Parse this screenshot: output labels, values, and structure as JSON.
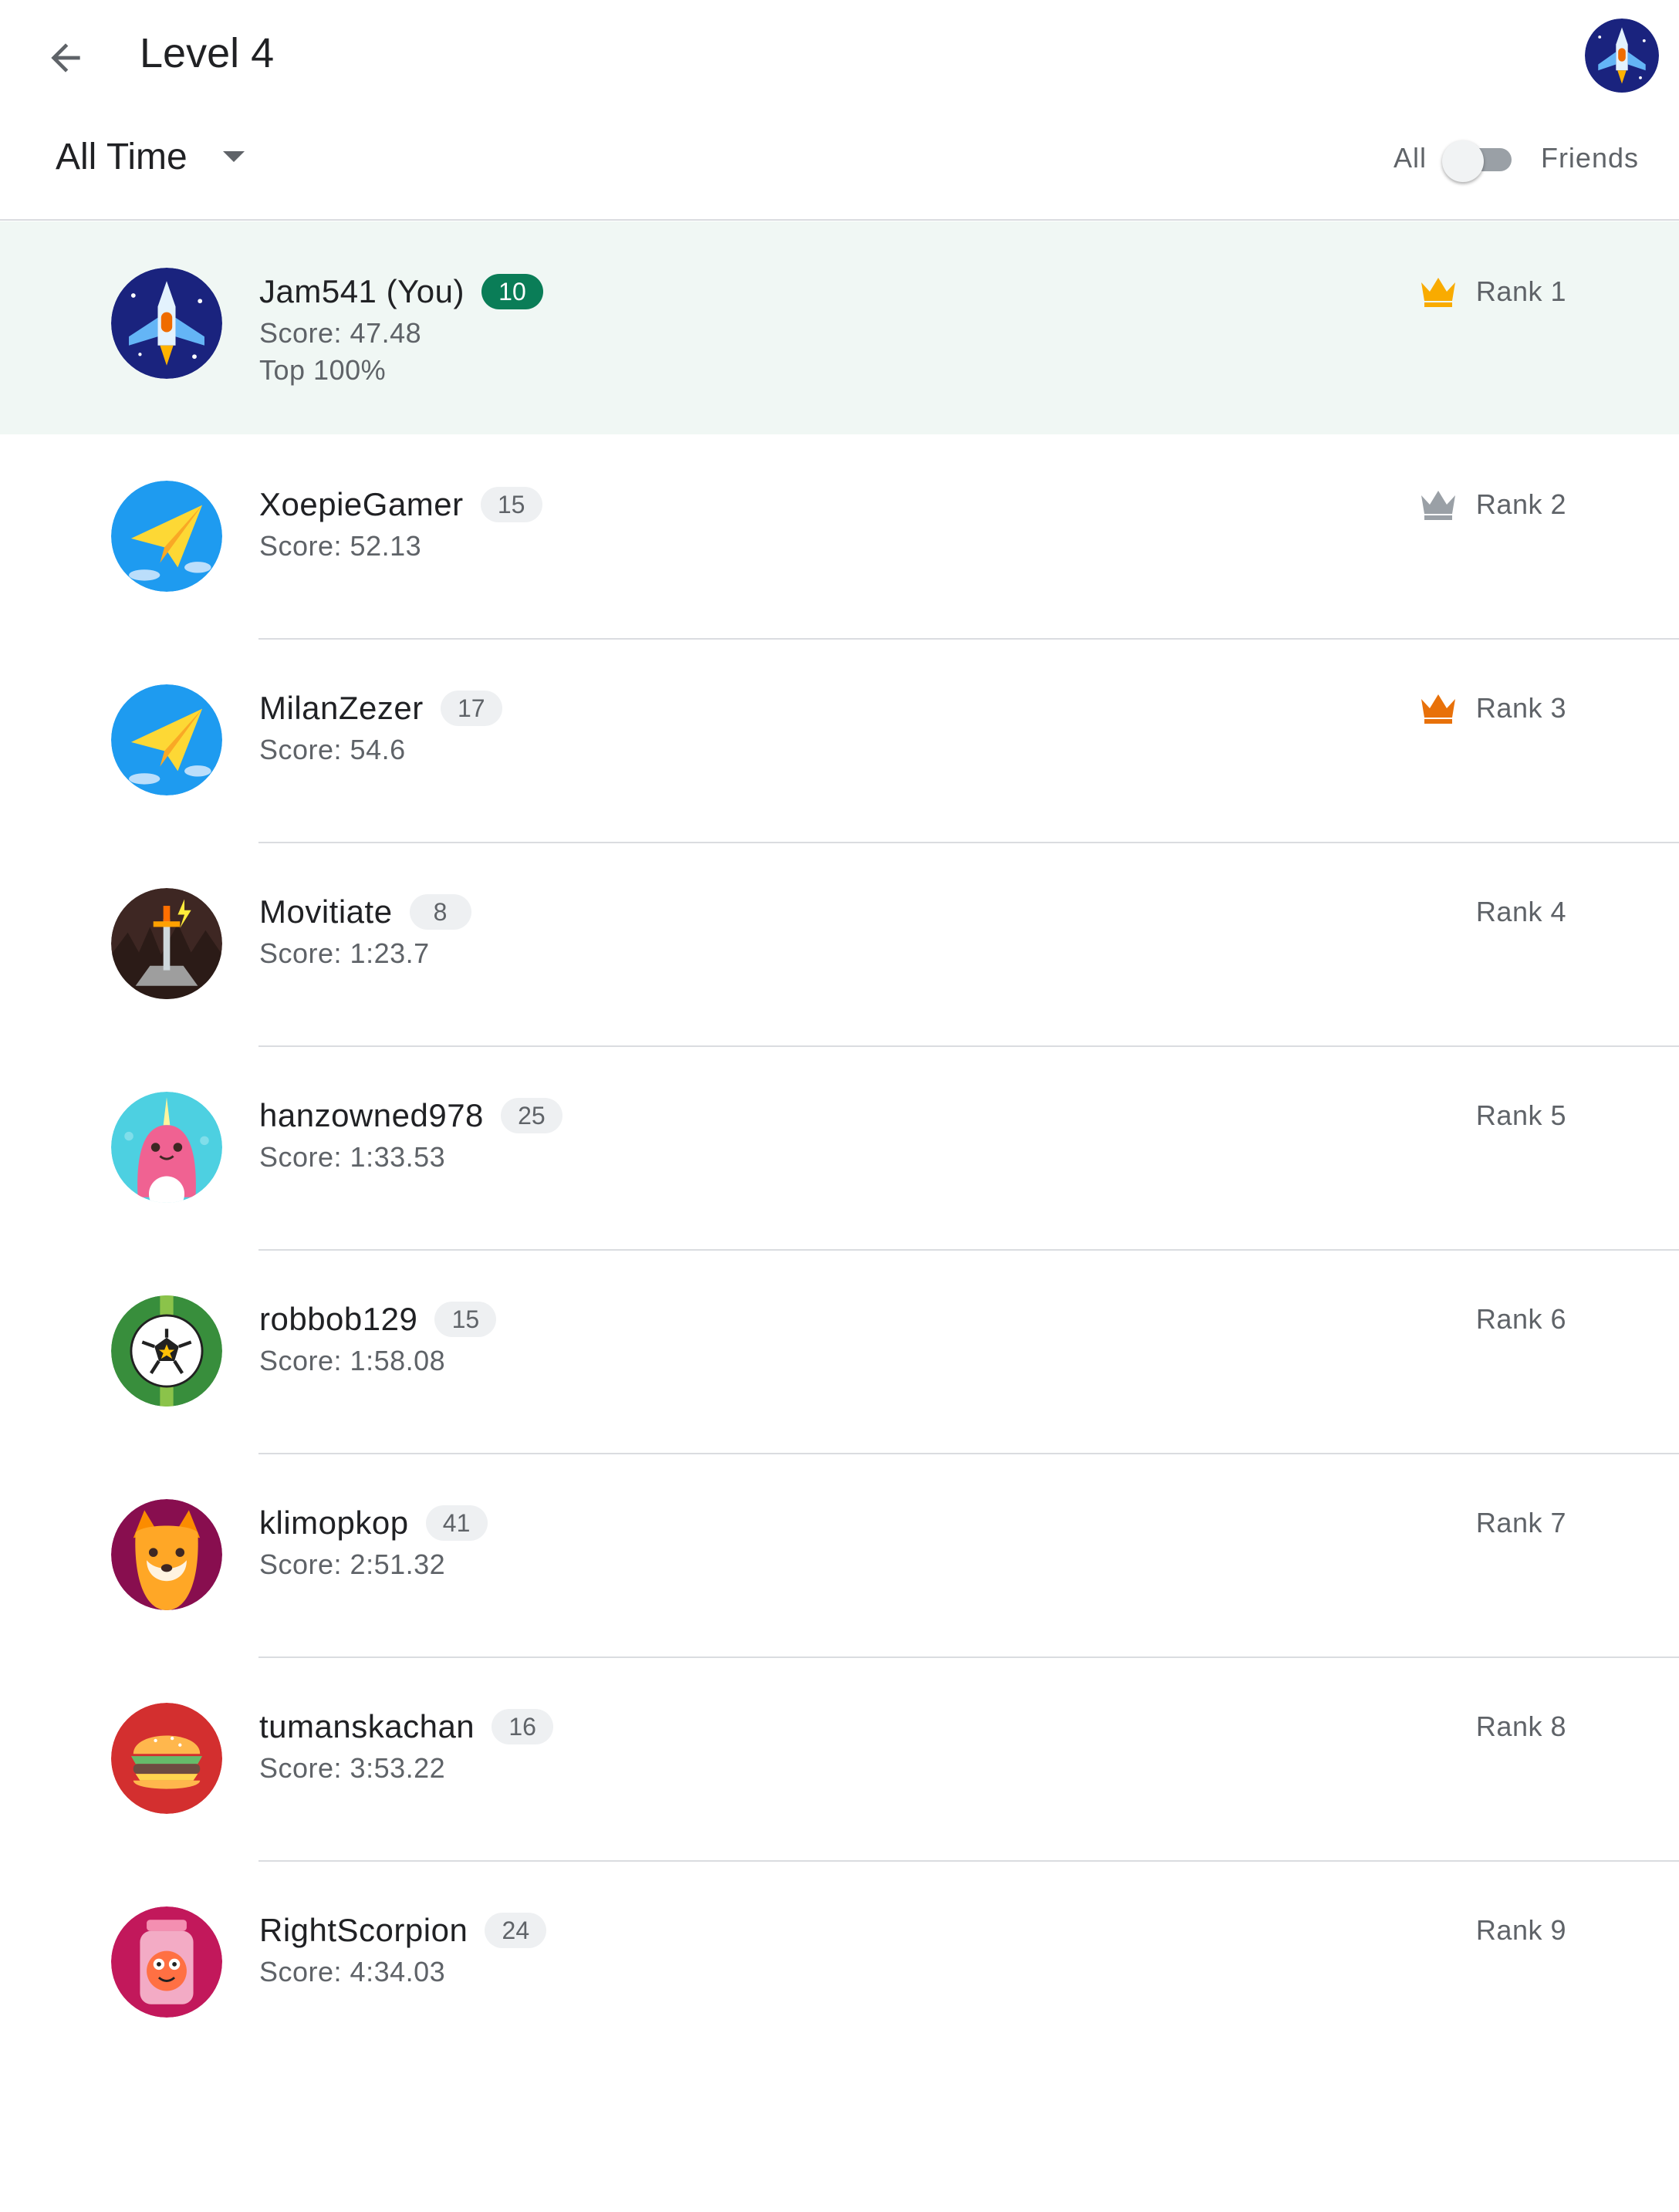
{
  "header": {
    "title": "Level 4",
    "back_icon": "arrow-left-icon",
    "profile_avatar_icon": "rocket-ship-avatar-icon"
  },
  "filters": {
    "timeframe": "All Time",
    "toggle_left_label": "All",
    "toggle_right_label": "Friends",
    "toggle_on": false
  },
  "players": [
    {
      "name": "Jam541 (You)",
      "level": "10",
      "score": "Score: 47.48",
      "top": "Top 100%",
      "rank": "Rank 1",
      "crown": "#f9ab00",
      "avatar": "rocket-ship",
      "current_user": true
    },
    {
      "name": "XoepieGamer",
      "level": "15",
      "score": "Score: 52.13",
      "rank": "Rank 2",
      "crown": "#9aa0a6",
      "avatar": "paper-plane"
    },
    {
      "name": "MilanZezer",
      "level": "17",
      "score": "Score: 54.6",
      "rank": "Rank 3",
      "crown": "#e8710a",
      "avatar": "paper-plane"
    },
    {
      "name": "Movitiate",
      "level": "8",
      "score": "Score: 1:23.7",
      "rank": "Rank 4",
      "avatar": "sword-in-stone"
    },
    {
      "name": "hanzowned978",
      "level": "25",
      "score": "Score: 1:33.53",
      "rank": "Rank 5",
      "avatar": "narwhal"
    },
    {
      "name": "robbob129",
      "level": "15",
      "score": "Score: 1:58.08",
      "rank": "Rank 6",
      "avatar": "soccer-ball"
    },
    {
      "name": "klimopkop",
      "level": "41",
      "score": "Score: 2:51.32",
      "rank": "Rank 7",
      "avatar": "shiba-dog"
    },
    {
      "name": "tumanskachan",
      "level": "16",
      "score": "Score: 3:53.22",
      "rank": "Rank 8",
      "avatar": "burger"
    },
    {
      "name": "RightScorpion",
      "level": "24",
      "score": "Score: 4:34.03",
      "rank": "Rank 9",
      "avatar": "monster-jar"
    }
  ],
  "colors": {
    "accent_green": "#0a7d57",
    "highlight_row": "#f0f7f4",
    "gold": "#f9ab00",
    "silver": "#9aa0a6",
    "bronze": "#e8710a"
  }
}
